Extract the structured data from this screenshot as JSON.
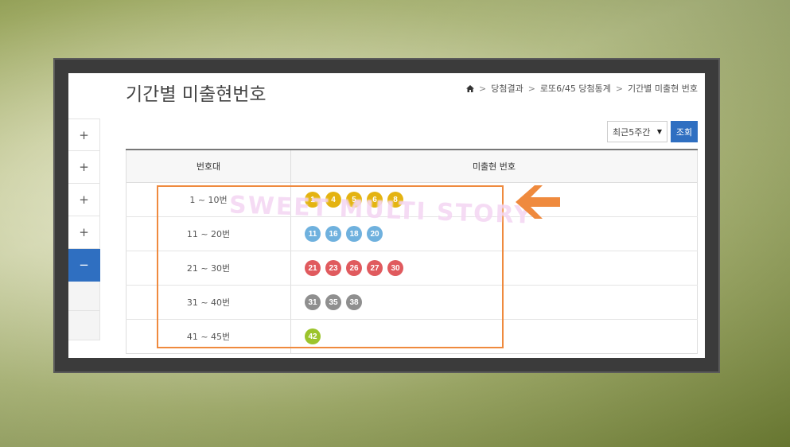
{
  "page": {
    "title": "기간별 미출현번호",
    "breadcrumb": [
      "당첨결과",
      "로또6/45 당첨통계",
      "기간별 미출현 번호"
    ]
  },
  "sidebar": {
    "items": [
      {
        "symbol": "+"
      },
      {
        "symbol": "+"
      },
      {
        "symbol": "+"
      },
      {
        "symbol": "+"
      },
      {
        "symbol": "−",
        "active": true
      }
    ]
  },
  "controls": {
    "period_select": "최근5주간",
    "query_label": "조회"
  },
  "table": {
    "headers": [
      "번호대",
      "미출현 번호"
    ],
    "rows": [
      {
        "range": "1 ~ 10번",
        "numbers": [
          1,
          4,
          5,
          6,
          8
        ],
        "color": "#e4b311"
      },
      {
        "range": "11 ~ 20번",
        "numbers": [
          11,
          16,
          18,
          20
        ],
        "color": "#6fb1de"
      },
      {
        "range": "21 ~ 30번",
        "numbers": [
          21,
          23,
          26,
          27,
          30
        ],
        "color": "#e05a5e"
      },
      {
        "range": "31 ~ 40번",
        "numbers": [
          31,
          35,
          38
        ],
        "color": "#8f8f8f"
      },
      {
        "range": "41 ~ 45번",
        "numbers": [
          42
        ],
        "color": "#9cc42c"
      }
    ]
  },
  "overlay": {
    "watermark": "SWEET MULTI STORY",
    "highlight_color": "#ef8a3e"
  }
}
